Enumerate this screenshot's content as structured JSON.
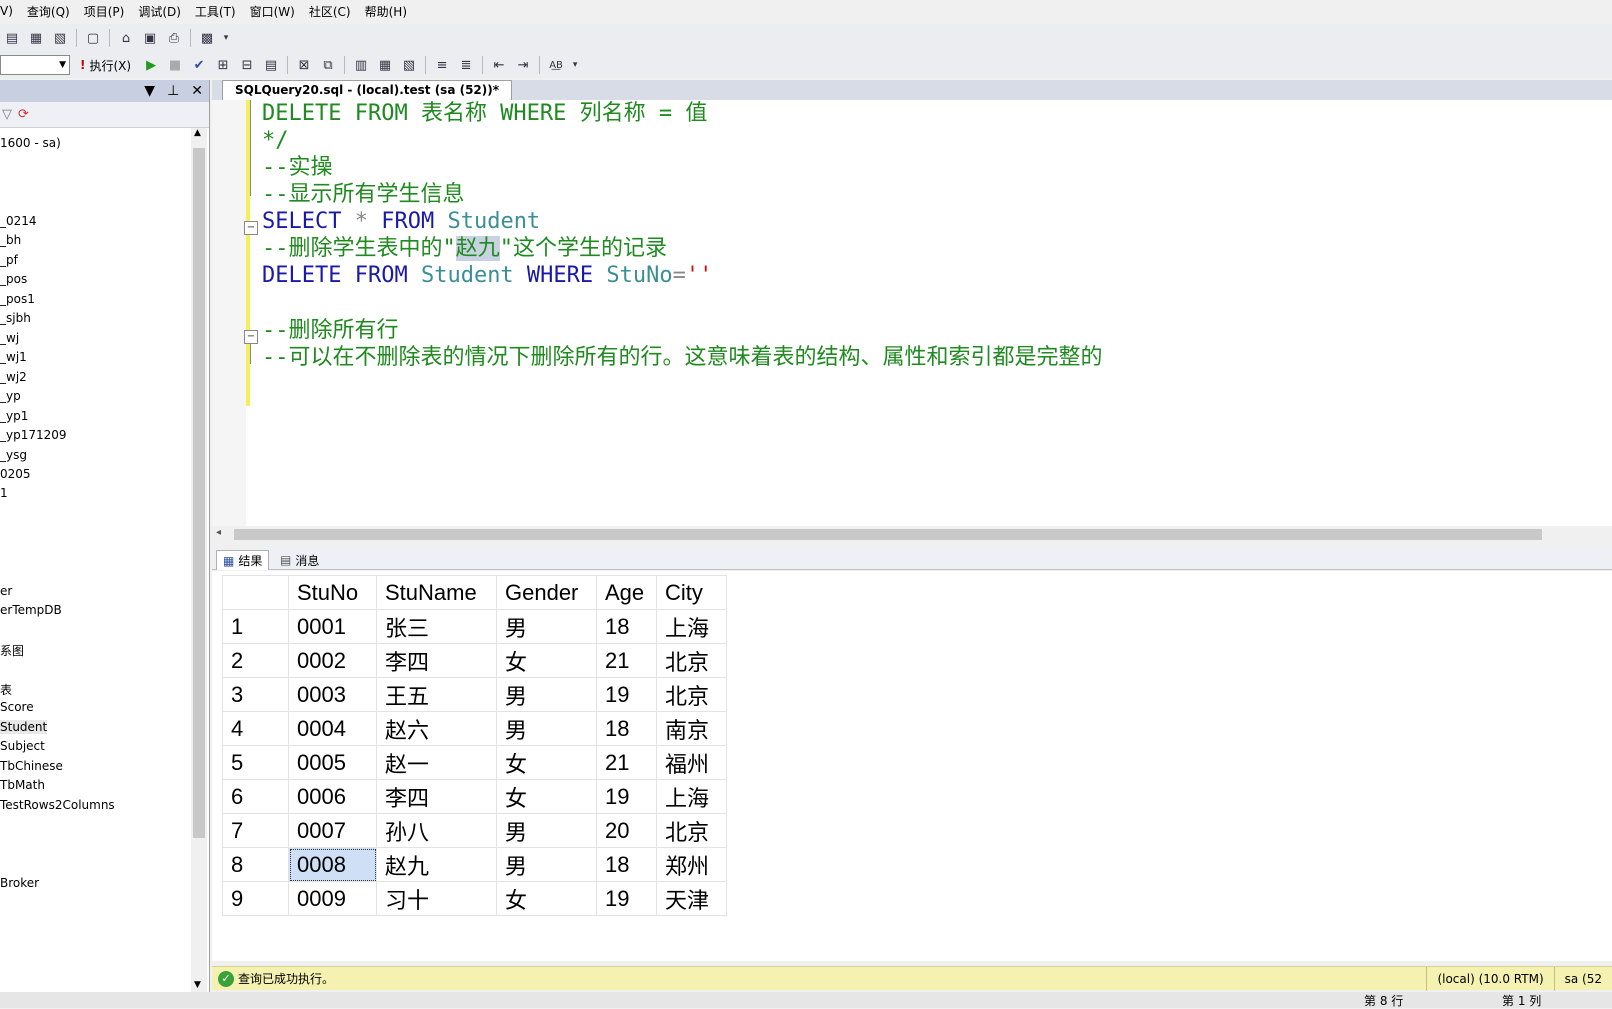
{
  "menu": [
    "V)",
    "查询(Q)",
    "项目(P)",
    "调试(D)",
    "工具(T)",
    "窗口(W)",
    "社区(C)",
    "帮助(H)"
  ],
  "toolbar": {
    "execute_label": "执行(X)"
  },
  "object_explorer": {
    "items": [
      "1600 - sa)",
      "_0214",
      "_bh",
      "_pf",
      "_pos",
      "_pos1",
      "_sjbh",
      "_wj",
      "_wj1",
      "_wj2",
      "_yp",
      "_yp1",
      "_yp171209",
      "_ysg",
      "0205",
      "1",
      "er",
      "erTempDB",
      "系图",
      "表",
      "Score",
      "Student",
      "Subject",
      "TbChinese",
      "TbMath",
      "TestRows2Columns",
      "Broker"
    ]
  },
  "editor": {
    "tab_title": "SQLQuery20.sql - (local).test (sa (52))*",
    "lines": {
      "l1": "DELETE FROM 表名称 WHERE 列名称 = 值",
      "l2": "*/",
      "l3": "--实操",
      "l4": "--显示所有学生信息",
      "l5_kw1": "SELECT",
      "l5_op": " * ",
      "l5_kw2": "FROM",
      "l5_obj": " Student",
      "l6_a": "--删除学生表中的\"",
      "l6_hl": "赵九",
      "l6_b": "\"这个学生的记录",
      "l7_kw1": "DELETE",
      "l7_kw2": " FROM",
      "l7_obj": " Student",
      "l7_kw3": " WHERE",
      "l7_obj2": " StuNo",
      "l7_op": "=",
      "l7_str": "''",
      "l8": "--删除所有行",
      "l9": "--可以在不删除表的情况下删除所有的行。这意味着表的结构、属性和索引都是完整的"
    }
  },
  "results_tabs": {
    "results": "结果",
    "messages": "消息"
  },
  "grid": {
    "columns": [
      "StuNo",
      "StuName",
      "Gender",
      "Age",
      "City"
    ],
    "rows": [
      [
        "1",
        "0001",
        "张三",
        "男",
        "18",
        "上海"
      ],
      [
        "2",
        "0002",
        "李四",
        "女",
        "21",
        "北京"
      ],
      [
        "3",
        "0003",
        "王五",
        "男",
        "19",
        "北京"
      ],
      [
        "4",
        "0004",
        "赵六",
        "男",
        "18",
        "南京"
      ],
      [
        "5",
        "0005",
        "赵一",
        "女",
        "21",
        "福州"
      ],
      [
        "6",
        "0006",
        "李四",
        "女",
        "19",
        "上海"
      ],
      [
        "7",
        "0007",
        "孙八",
        "男",
        "20",
        "北京"
      ],
      [
        "8",
        "0008",
        "赵九",
        "男",
        "18",
        "郑州"
      ],
      [
        "9",
        "0009",
        "习十",
        "女",
        "19",
        "天津"
      ]
    ]
  },
  "status": {
    "message": "查询已成功执行。",
    "server": "(local) (10.0 RTM)",
    "user": "sa (52",
    "row": "第 8 行",
    "col": "第 1 列"
  },
  "colors": {
    "accent_status": "#f5f1b0",
    "keyword": "#1a1aa8",
    "comment": "#1f8a1f",
    "object": "#3a8f96"
  }
}
